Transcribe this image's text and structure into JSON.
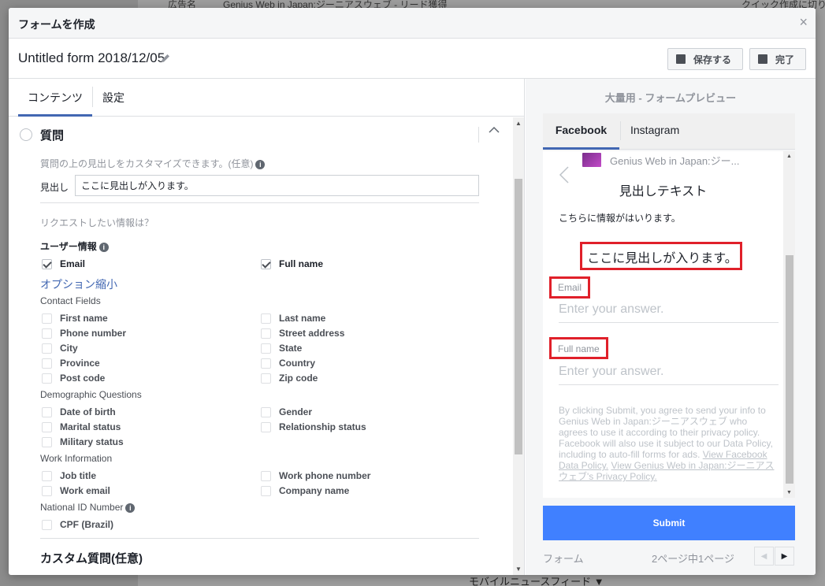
{
  "background": {
    "top_text_1": "広告名",
    "top_text_2": "Genius Web in Japan:ジーニアスウェブ - リード獲得",
    "top_text_3": "クイック作成に切り",
    "bottom_text": "モバイルニュースフィード ▼"
  },
  "modal": {
    "title": "フォームを作成",
    "close": "×"
  },
  "toolbar": {
    "form_name": "Untitled form 2018/12/05",
    "save_label": "保存する",
    "done_label": "完了"
  },
  "left": {
    "tabs": [
      {
        "label": "コンテンツ",
        "active": true
      },
      {
        "label": "設定",
        "active": false
      }
    ],
    "section_title": "質問",
    "headline_hint": "質問の上の見出しをカスタマイズできます。(任意)",
    "headline_label": "見出し",
    "headline_value": "ここに見出しが入ります。",
    "request_prompt": "リクエストしたい情報は？",
    "user_info_title": "ユーザー情報",
    "user_info_items": [
      {
        "label": "Email",
        "checked": true
      },
      {
        "label": "Full name",
        "checked": true
      }
    ],
    "collapse_link": "オプション縮小",
    "contact_fields_title": "Contact Fields",
    "contact_fields": [
      {
        "label": "First name",
        "checked": false
      },
      {
        "label": "Last name",
        "checked": false
      },
      {
        "label": "Phone number",
        "checked": false
      },
      {
        "label": "Street address",
        "checked": false
      },
      {
        "label": "City",
        "checked": false
      },
      {
        "label": "State",
        "checked": false
      },
      {
        "label": "Province",
        "checked": false
      },
      {
        "label": "Country",
        "checked": false
      },
      {
        "label": "Post code",
        "checked": false
      },
      {
        "label": "Zip code",
        "checked": false
      }
    ],
    "demographic_title": "Demographic Questions",
    "demographic_fields": [
      {
        "label": "Date of birth",
        "checked": false
      },
      {
        "label": "Gender",
        "checked": false
      },
      {
        "label": "Marital status",
        "checked": false
      },
      {
        "label": "Relationship status",
        "checked": false
      },
      {
        "label": "Military status",
        "checked": false
      }
    ],
    "work_title": "Work Information",
    "work_fields": [
      {
        "label": "Job title",
        "checked": false
      },
      {
        "label": "Work phone number",
        "checked": false
      },
      {
        "label": "Work email",
        "checked": false
      },
      {
        "label": "Company name",
        "checked": false
      }
    ],
    "national_id_title": "National ID Number",
    "national_id_fields": [
      {
        "label": "CPF (Brazil)",
        "checked": false
      }
    ],
    "custom_title": "カスタム質問(任意)"
  },
  "preview": {
    "title": "大量用 - フォームプレビュー",
    "tabs": [
      {
        "label": "Facebook",
        "active": true
      },
      {
        "label": "Instagram",
        "active": false
      }
    ],
    "page_name": "Genius Web in Japan:ジー...",
    "headline": "見出しテキスト",
    "description": "こちらに情報がはいります。",
    "question_headline": "ここに見出しが入ります。",
    "fields": [
      {
        "label": "Email",
        "placeholder": "Enter your answer."
      },
      {
        "label": "Full name",
        "placeholder": "Enter your answer."
      }
    ],
    "disclaimer_text": "By clicking Submit, you agree to send your info to Genius Web in Japan:ジーニアスウェブ who agrees to use it according to their privacy policy. Facebook will also use it subject to our Data Policy, including to auto-fill forms for ads. ",
    "disclaimer_link1": "View Facebook Data Policy.",
    "disclaimer_link2": "View Genius Web in Japan:ジーニアスウェブ's Privacy Policy.",
    "submit_label": "Submit",
    "footer_label": "フォーム",
    "page_indicator": "2ページ中1ページ"
  },
  "colors": {
    "accent": "#4267b2",
    "submit": "#4080ff",
    "highlight": "#e0202a"
  }
}
